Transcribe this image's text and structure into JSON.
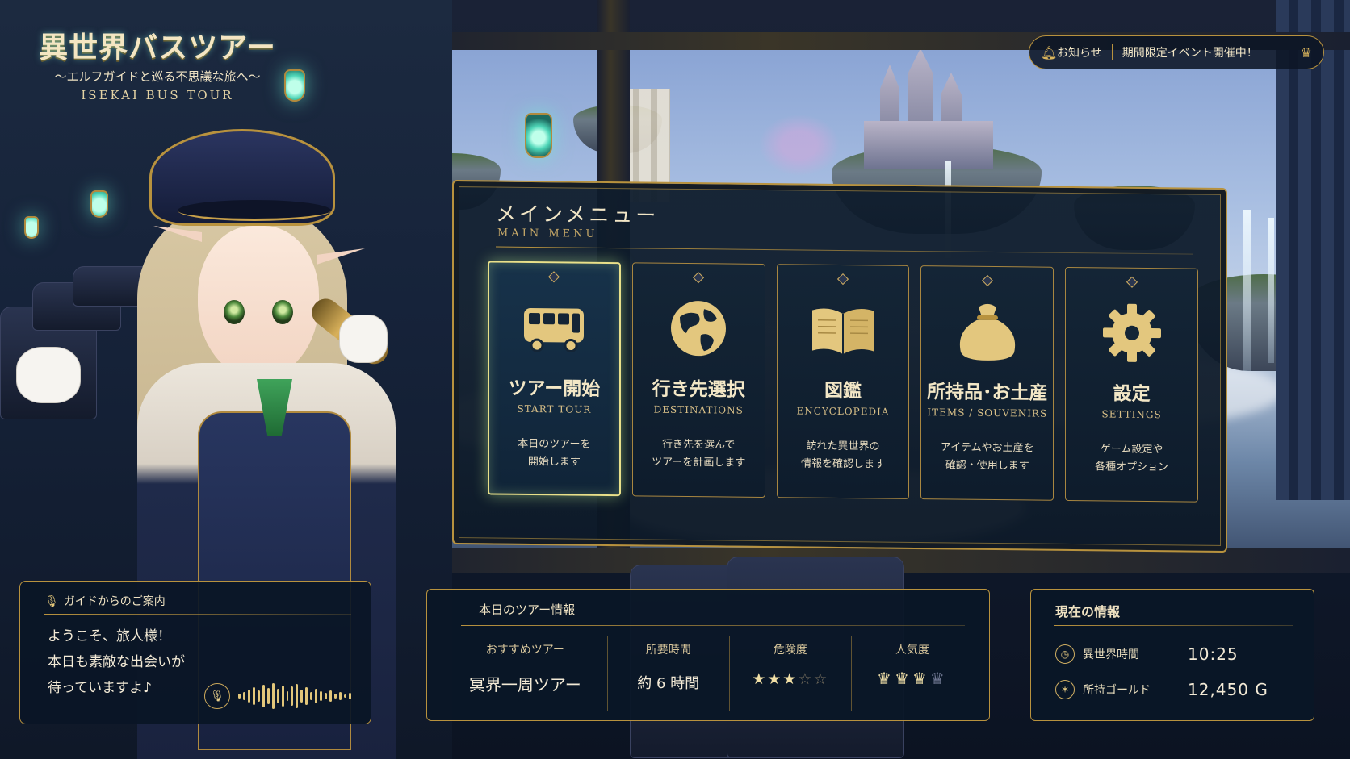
{
  "logo": {
    "title": "異世界バスツアー",
    "subtitle": "〜エルフガイドと巡る不思議な旅へ〜",
    "english": "ISEKAI BUS TOUR"
  },
  "notice": {
    "bell_icon": "bell-icon",
    "label": "お知らせ",
    "message": "期間限定イベント開催中！",
    "crown_icon": "crown-icon"
  },
  "menu": {
    "title": "メインメニュー",
    "title_en": "MAIN MENU",
    "items": [
      {
        "label": "ツアー開始",
        "label_en": "START TOUR",
        "desc": "本日のツアーを\n開始します",
        "icon": "bus-icon",
        "selected": true
      },
      {
        "label": "行き先選択",
        "label_en": "DESTINATIONS",
        "desc": "行き先を選んで\nツアーを計画します",
        "icon": "globe-icon",
        "selected": false
      },
      {
        "label": "図鑑",
        "label_en": "ENCYCLOPEDIA",
        "desc": "訪れた異世界の\n情報を確認します",
        "icon": "book-icon",
        "selected": false
      },
      {
        "label": "所持品･お土産",
        "label_en": "ITEMS / SOUVENIRS",
        "desc": "アイテムやお土産を\n確認・使用します",
        "icon": "bag-icon",
        "selected": false
      },
      {
        "label": "設定",
        "label_en": "SETTINGS",
        "desc": "ゲーム設定や\n各種オプション",
        "icon": "gear-icon",
        "selected": false
      }
    ]
  },
  "guide": {
    "heading": "ガイドからのご案内",
    "lines": [
      "ようこそ、旅人様！",
      "本日も素敵な出会いが",
      "待っていますよ♪"
    ]
  },
  "tour": {
    "heading": "本日のツアー情報",
    "recommended_label": "おすすめツアー",
    "recommended_value": "冥界一周ツアー",
    "duration_label": "所要時間",
    "duration_value": "約 6 時間",
    "danger_label": "危険度",
    "danger_rating": 3,
    "danger_max": 5,
    "popularity_label": "人気度",
    "popularity_rating": 3,
    "popularity_max": 4
  },
  "status": {
    "heading": "現在の情報",
    "time_label": "異世界時間",
    "time_value": "10:25",
    "gold_label": "所持ゴールド",
    "gold_value": "12,450 G"
  },
  "colors": {
    "gold": "#b8923e",
    "panel": "#0e1c2c",
    "highlight": "#e9e08a"
  }
}
